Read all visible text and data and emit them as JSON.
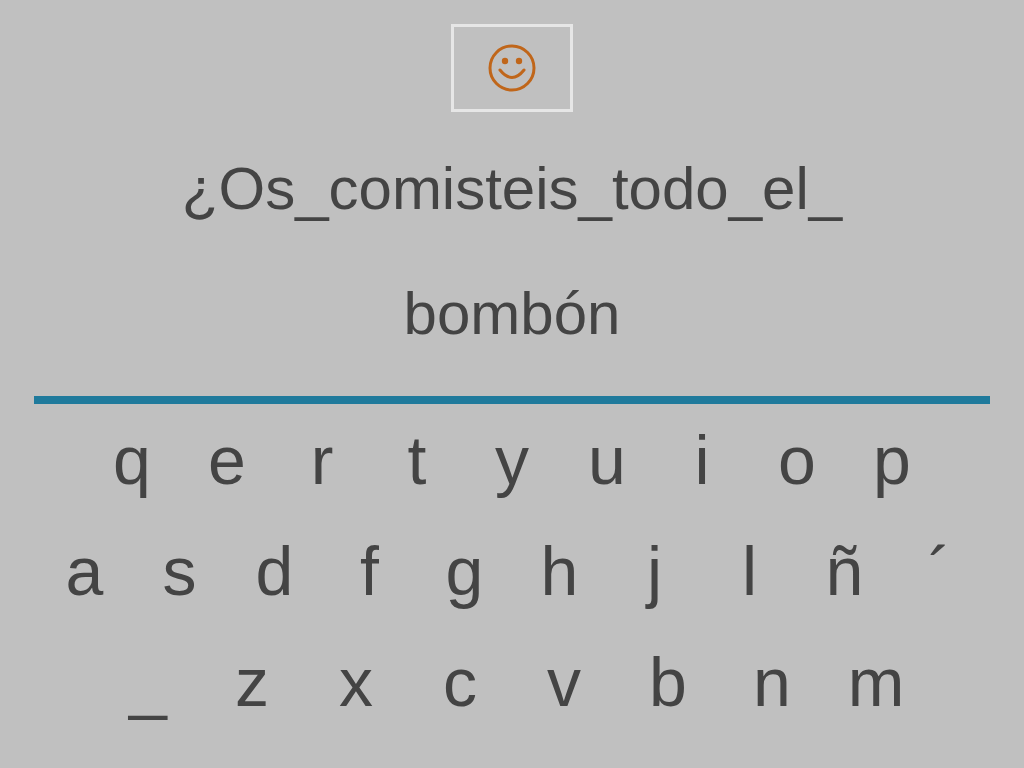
{
  "prompt_lines": [
    "¿Os_comisteis_todo_el_",
    "bombón"
  ],
  "keyboard_rows": [
    [
      "q",
      "e",
      "r",
      "t",
      "y",
      "u",
      "i",
      "o",
      "p"
    ],
    [
      "a",
      "s",
      "d",
      "f",
      "g",
      "h",
      "j",
      "l",
      "ñ",
      "´"
    ],
    [
      "_",
      "z",
      "x",
      "c",
      "v",
      "b",
      "n",
      "m"
    ]
  ]
}
